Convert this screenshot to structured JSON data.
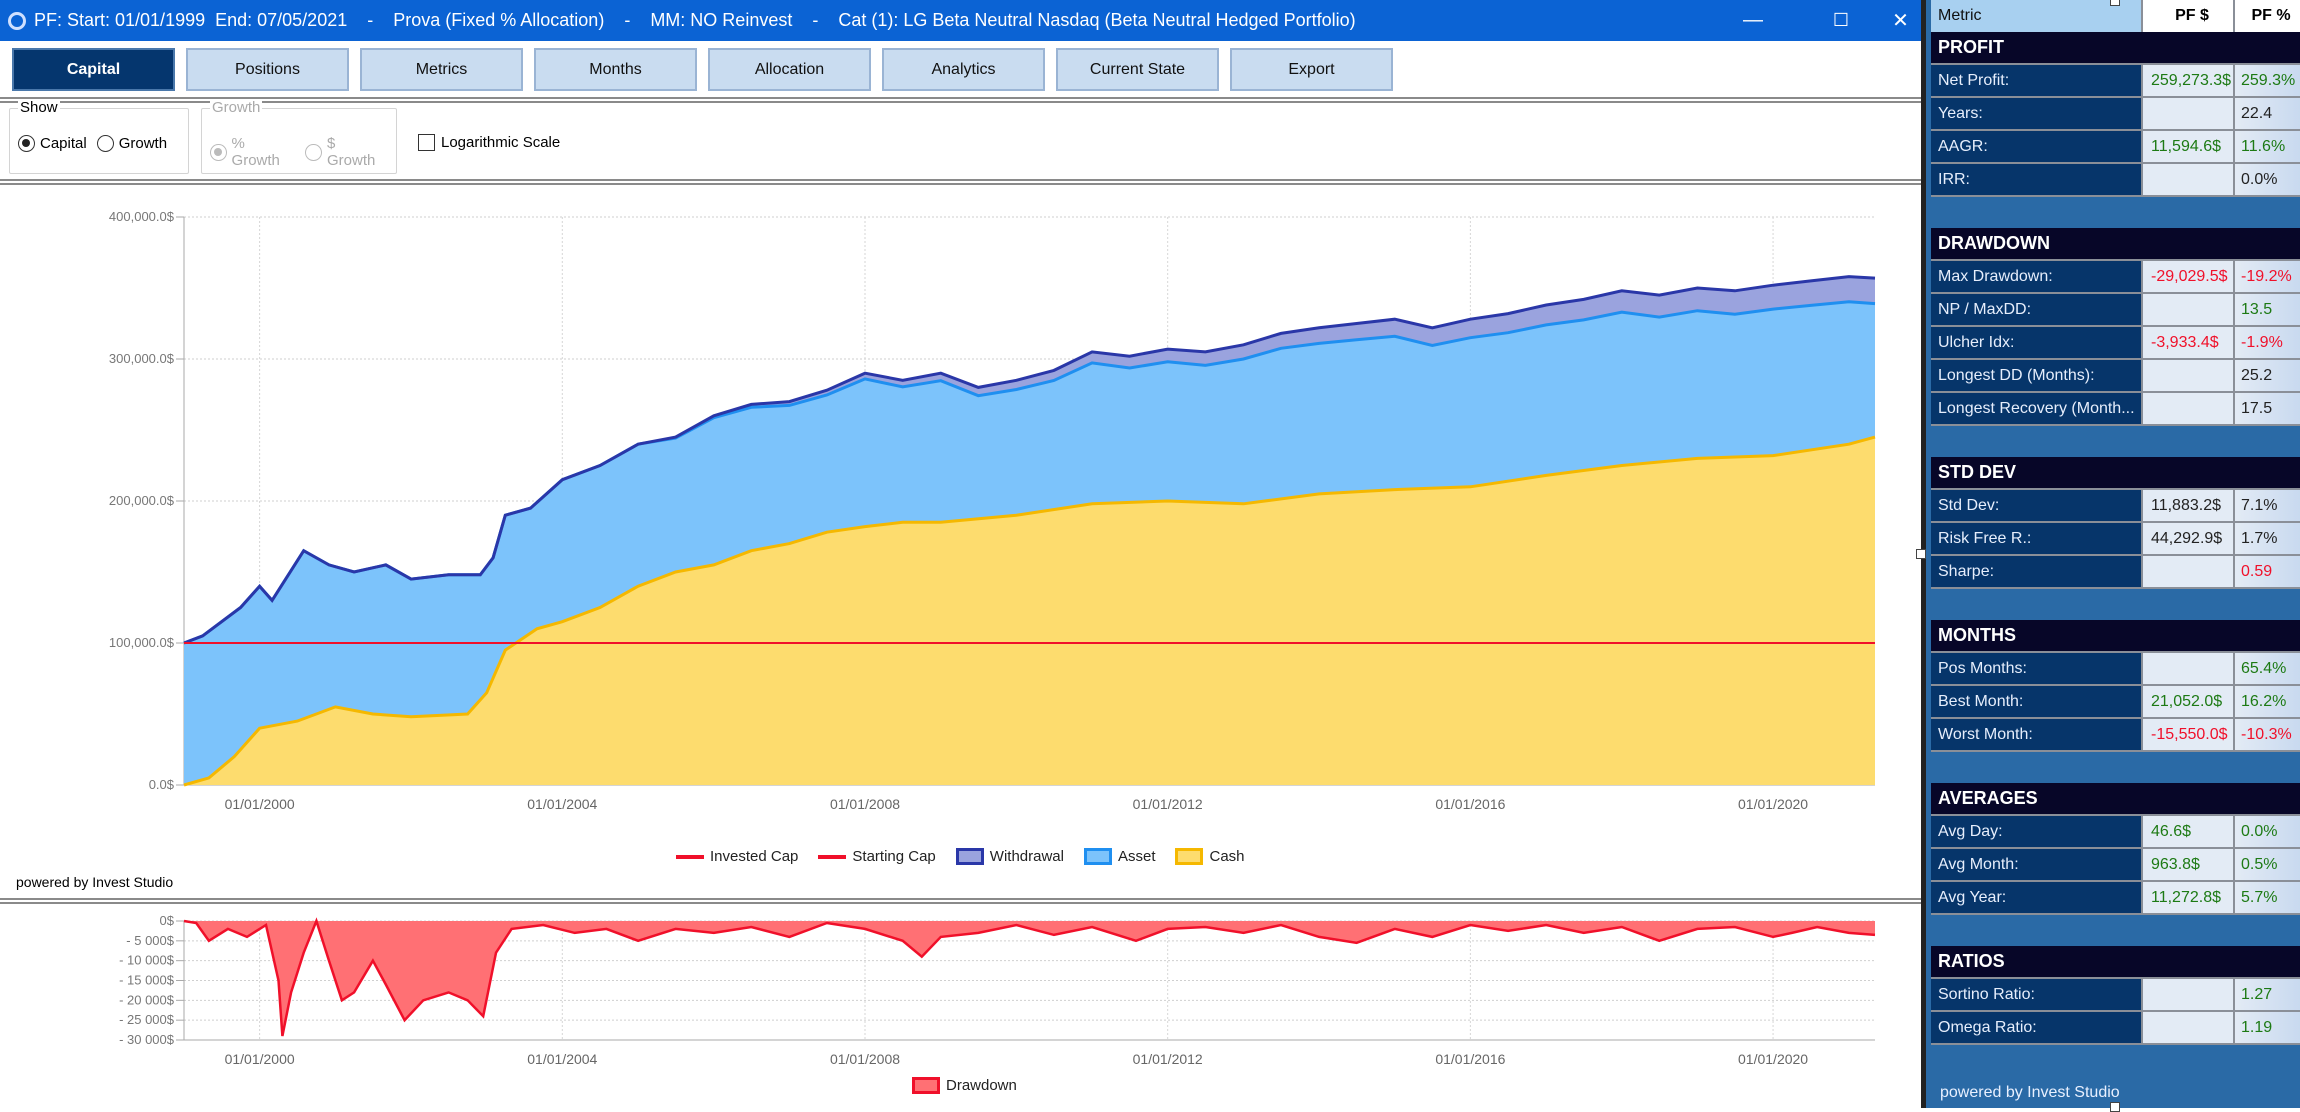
{
  "window": {
    "title": "PF: Start: 01/01/1999  End: 07/05/2021    -    Prova (Fixed % Allocation)    -    MM: NO Reinvest    -    Cat (1): LG Beta Neutral Nasdaq (Beta Neutral Hedged Portfolio)",
    "minimize": "—",
    "maximize": "☐",
    "close": "✕"
  },
  "tabs": [
    {
      "label": "Capital",
      "active": true
    },
    {
      "label": "Positions"
    },
    {
      "label": "Metrics"
    },
    {
      "label": "Months"
    },
    {
      "label": "Allocation"
    },
    {
      "label": "Analytics"
    },
    {
      "label": "Current State"
    },
    {
      "label": "Export"
    }
  ],
  "options": {
    "show_label": "Show",
    "capital": "Capital",
    "growth": "Growth",
    "growth_label": "Growth",
    "pct_growth": "% Growth",
    "usd_growth": "$ Growth",
    "log_scale": "Logarithmic Scale",
    "selected_show": "Capital",
    "selected_growth": "% Growth",
    "log_checked": false
  },
  "powered_by": "powered by Invest Studio",
  "chart_data": [
    {
      "type": "area",
      "title": "",
      "xlabel": "",
      "ylabel": "",
      "xlim": [
        "1999-01-01",
        "2021-05-07"
      ],
      "ylim": [
        0,
        400000
      ],
      "grid": true,
      "legend_placement": "bottom",
      "yticks": [
        {
          "v": 0,
          "label": "0.0$"
        },
        {
          "v": 100000,
          "label": "100,000.0$"
        },
        {
          "v": 200000,
          "label": "200,000.0$"
        },
        {
          "v": 300000,
          "label": "300,000.0$"
        },
        {
          "v": 400000,
          "label": "400,000.0$"
        }
      ],
      "xticks": [
        {
          "d": "2000-01-01",
          "label": "01/01/2000"
        },
        {
          "d": "2004-01-01",
          "label": "01/01/2004"
        },
        {
          "d": "2008-01-01",
          "label": "01/01/2008"
        },
        {
          "d": "2012-01-01",
          "label": "01/01/2012"
        },
        {
          "d": "2016-01-01",
          "label": "01/01/2016"
        },
        {
          "d": "2020-01-01",
          "label": "01/01/2020"
        }
      ],
      "colors": {
        "invested": "#f0102a",
        "starting": "#f0102a",
        "withdrawal_fill": "#9aa3de",
        "withdrawal_line": "#2a37a8",
        "asset_fill": "#7cc3fb",
        "asset_line": "#1f8ff0",
        "cash_fill": "#fddc6e",
        "cash_line": "#f5b800"
      },
      "legend": [
        "Invested Cap",
        "Starting Cap",
        "Withdrawal",
        "Asset",
        "Cash"
      ],
      "series": {
        "total": [
          [
            "1999-01-01",
            100000
          ],
          [
            "1999-04-01",
            105000
          ],
          [
            "1999-10-01",
            125000
          ],
          [
            "2000-01-01",
            140000
          ],
          [
            "2000-03-01",
            130000
          ],
          [
            "2000-08-01",
            165000
          ],
          [
            "2000-12-01",
            155000
          ],
          [
            "2001-04-01",
            150000
          ],
          [
            "2001-09-01",
            155000
          ],
          [
            "2002-01-01",
            145000
          ],
          [
            "2002-07-01",
            148000
          ],
          [
            "2002-12-01",
            148000
          ],
          [
            "2003-02-01",
            160000
          ],
          [
            "2003-04-01",
            190000
          ],
          [
            "2003-08-01",
            195000
          ],
          [
            "2004-01-01",
            215000
          ],
          [
            "2004-07-01",
            225000
          ],
          [
            "2005-01-01",
            240000
          ],
          [
            "2005-07-01",
            245000
          ],
          [
            "2006-01-01",
            260000
          ],
          [
            "2006-07-01",
            268000
          ],
          [
            "2007-01-01",
            270000
          ],
          [
            "2007-07-01",
            278000
          ],
          [
            "2008-01-01",
            290000
          ],
          [
            "2008-07-01",
            285000
          ],
          [
            "2009-01-01",
            290000
          ],
          [
            "2009-07-01",
            280000
          ],
          [
            "2010-01-01",
            285000
          ],
          [
            "2010-07-01",
            292000
          ],
          [
            "2011-01-01",
            305000
          ],
          [
            "2011-07-01",
            302000
          ],
          [
            "2012-01-01",
            307000
          ],
          [
            "2012-07-01",
            305000
          ],
          [
            "2013-01-01",
            310000
          ],
          [
            "2013-07-01",
            318000
          ],
          [
            "2014-01-01",
            322000
          ],
          [
            "2014-07-01",
            325000
          ],
          [
            "2015-01-01",
            328000
          ],
          [
            "2015-07-01",
            322000
          ],
          [
            "2016-01-01",
            328000
          ],
          [
            "2016-07-01",
            332000
          ],
          [
            "2017-01-01",
            338000
          ],
          [
            "2017-07-01",
            342000
          ],
          [
            "2018-01-01",
            348000
          ],
          [
            "2018-07-01",
            345000
          ],
          [
            "2019-01-01",
            350000
          ],
          [
            "2019-07-01",
            348000
          ],
          [
            "2020-01-01",
            352000
          ],
          [
            "2020-07-01",
            355000
          ],
          [
            "2021-01-01",
            358000
          ],
          [
            "2021-05-07",
            357000
          ]
        ],
        "withdrawal": [
          [
            "1999-01-01",
            0
          ],
          [
            "2005-01-01",
            0
          ],
          [
            "2008-01-01",
            4000
          ],
          [
            "2012-01-01",
            9000
          ],
          [
            "2016-01-01",
            13000
          ],
          [
            "2019-01-01",
            16000
          ],
          [
            "2021-05-07",
            18000
          ]
        ],
        "cash": [
          [
            "1999-01-01",
            0
          ],
          [
            "1999-05-01",
            5000
          ],
          [
            "1999-09-01",
            20000
          ],
          [
            "2000-01-01",
            40000
          ],
          [
            "2000-07-01",
            45000
          ],
          [
            "2001-01-01",
            55000
          ],
          [
            "2001-07-01",
            50000
          ],
          [
            "2002-01-01",
            48000
          ],
          [
            "2002-10-01",
            50000
          ],
          [
            "2003-01-01",
            65000
          ],
          [
            "2003-04-01",
            95000
          ],
          [
            "2003-09-01",
            110000
          ],
          [
            "2004-01-01",
            115000
          ],
          [
            "2004-07-01",
            125000
          ],
          [
            "2005-01-01",
            140000
          ],
          [
            "2005-07-01",
            150000
          ],
          [
            "2006-01-01",
            155000
          ],
          [
            "2006-07-01",
            165000
          ],
          [
            "2007-01-01",
            170000
          ],
          [
            "2007-07-01",
            178000
          ],
          [
            "2008-01-01",
            182000
          ],
          [
            "2008-07-01",
            185000
          ],
          [
            "2009-01-01",
            185000
          ],
          [
            "2010-01-01",
            190000
          ],
          [
            "2011-01-01",
            198000
          ],
          [
            "2012-01-01",
            200000
          ],
          [
            "2013-01-01",
            198000
          ],
          [
            "2014-01-01",
            205000
          ],
          [
            "2015-01-01",
            208000
          ],
          [
            "2016-01-01",
            210000
          ],
          [
            "2017-01-01",
            218000
          ],
          [
            "2018-01-01",
            225000
          ],
          [
            "2019-01-01",
            230000
          ],
          [
            "2020-01-01",
            232000
          ],
          [
            "2021-01-01",
            240000
          ],
          [
            "2021-05-07",
            245000
          ]
        ],
        "invested_cap": 100000,
        "starting_cap": 100000
      }
    },
    {
      "type": "area",
      "title": "",
      "xlabel": "",
      "ylabel": "",
      "xlim": [
        "1999-01-01",
        "2021-05-07"
      ],
      "ylim": [
        -30000,
        0
      ],
      "grid": true,
      "legend_placement": "bottom",
      "yticks": [
        {
          "v": 0,
          "label": "0$"
        },
        {
          "v": -5000,
          "label": "- 5 000$"
        },
        {
          "v": -10000,
          "label": "- 10 000$"
        },
        {
          "v": -15000,
          "label": "- 15 000$"
        },
        {
          "v": -20000,
          "label": "- 20 000$"
        },
        {
          "v": -25000,
          "label": "- 25 000$"
        },
        {
          "v": -30000,
          "label": "- 30 000$"
        }
      ],
      "xticks": [
        {
          "d": "2000-01-01",
          "label": "01/01/2000"
        },
        {
          "d": "2004-01-01",
          "label": "01/01/2004"
        },
        {
          "d": "2008-01-01",
          "label": "01/01/2008"
        },
        {
          "d": "2012-01-01",
          "label": "01/01/2012"
        },
        {
          "d": "2016-01-01",
          "label": "01/01/2016"
        },
        {
          "d": "2020-01-01",
          "label": "01/01/2020"
        }
      ],
      "colors": {
        "fill": "#ff7074",
        "line": "#f0102a"
      },
      "legend": [
        "Drawdown"
      ],
      "series": {
        "drawdown": [
          [
            "1999-01-01",
            0
          ],
          [
            "1999-03-01",
            -500
          ],
          [
            "1999-05-01",
            -5000
          ],
          [
            "1999-08-01",
            -2000
          ],
          [
            "1999-11-01",
            -4000
          ],
          [
            "2000-02-01",
            -1000
          ],
          [
            "2000-04-01",
            -15000
          ],
          [
            "2000-04-20",
            -29000
          ],
          [
            "2000-06-01",
            -18000
          ],
          [
            "2000-08-01",
            -8000
          ],
          [
            "2000-10-01",
            0
          ],
          [
            "2000-12-01",
            -10000
          ],
          [
            "2001-02-01",
            -20000
          ],
          [
            "2001-04-01",
            -18000
          ],
          [
            "2001-07-01",
            -10000
          ],
          [
            "2001-09-01",
            -16000
          ],
          [
            "2001-12-01",
            -25000
          ],
          [
            "2002-03-01",
            -20000
          ],
          [
            "2002-07-01",
            -18000
          ],
          [
            "2002-10-01",
            -20000
          ],
          [
            "2002-12-15",
            -24000
          ],
          [
            "2003-02-15",
            -8000
          ],
          [
            "2003-05-01",
            -2000
          ],
          [
            "2003-10-01",
            -1000
          ],
          [
            "2004-03-01",
            -3000
          ],
          [
            "2004-08-01",
            -2000
          ],
          [
            "2005-01-01",
            -5000
          ],
          [
            "2005-07-01",
            -2000
          ],
          [
            "2006-01-01",
            -3000
          ],
          [
            "2006-07-01",
            -1500
          ],
          [
            "2007-01-01",
            -4000
          ],
          [
            "2007-07-01",
            -500
          ],
          [
            "2008-01-01",
            -2000
          ],
          [
            "2008-07-01",
            -5000
          ],
          [
            "2008-10-01",
            -9000
          ],
          [
            "2009-01-01",
            -4000
          ],
          [
            "2009-07-01",
            -3000
          ],
          [
            "2010-01-01",
            -1000
          ],
          [
            "2010-07-01",
            -3500
          ],
          [
            "2011-01-01",
            -1500
          ],
          [
            "2011-08-01",
            -5000
          ],
          [
            "2012-01-01",
            -2000
          ],
          [
            "2012-07-01",
            -1500
          ],
          [
            "2013-01-01",
            -3000
          ],
          [
            "2013-07-01",
            -1000
          ],
          [
            "2014-01-01",
            -4000
          ],
          [
            "2014-07-01",
            -5500
          ],
          [
            "2015-01-01",
            -2000
          ],
          [
            "2015-07-01",
            -4000
          ],
          [
            "2016-01-01",
            -1000
          ],
          [
            "2016-07-01",
            -2500
          ],
          [
            "2017-01-01",
            -1000
          ],
          [
            "2017-07-01",
            -3000
          ],
          [
            "2018-01-01",
            -1500
          ],
          [
            "2018-07-01",
            -5000
          ],
          [
            "2019-01-01",
            -2000
          ],
          [
            "2019-07-01",
            -1500
          ],
          [
            "2020-01-01",
            -4000
          ],
          [
            "2020-04-01",
            -3000
          ],
          [
            "2020-08-01",
            -1500
          ],
          [
            "2021-01-01",
            -3000
          ],
          [
            "2021-05-07",
            -3500
          ]
        ]
      }
    }
  ],
  "metrics": {
    "headers": [
      "Metric",
      "PF $",
      "PF %"
    ],
    "sections": [
      {
        "title": "PROFIT",
        "rows": [
          {
            "m": "Net Profit:",
            "v1": "259,273.3$",
            "v2": "259.3%",
            "c1": "pos",
            "c2": "pos"
          },
          {
            "m": "Years:",
            "v1": "",
            "v2": "22.4",
            "c1": "neu",
            "c2": "neu"
          },
          {
            "m": "AAGR:",
            "v1": "11,594.6$",
            "v2": "11.6%",
            "c1": "pos",
            "c2": "pos"
          },
          {
            "m": "IRR:",
            "v1": "",
            "v2": "0.0%",
            "c1": "neu",
            "c2": "neu"
          }
        ]
      },
      {
        "title": "DRAWDOWN",
        "rows": [
          {
            "m": "Max Drawdown:",
            "v1": "-29,029.5$",
            "v2": "-19.2%",
            "c1": "neg",
            "c2": "neg"
          },
          {
            "m": "NP / MaxDD:",
            "v1": "",
            "v2": "13.5",
            "c1": "neu",
            "c2": "pos"
          },
          {
            "m": "Ulcher Idx:",
            "v1": "-3,933.4$",
            "v2": "-1.9%",
            "c1": "neg",
            "c2": "neg"
          },
          {
            "m": "Longest DD (Months):",
            "v1": "",
            "v2": "25.2",
            "c1": "neu",
            "c2": "neu"
          },
          {
            "m": "Longest Recovery (Month...",
            "v1": "",
            "v2": "17.5",
            "c1": "neu",
            "c2": "neu"
          }
        ]
      },
      {
        "title": "STD DEV",
        "rows": [
          {
            "m": "Std Dev:",
            "v1": "11,883.2$",
            "v2": "7.1%",
            "c1": "neu",
            "c2": "neu"
          },
          {
            "m": "Risk Free R.:",
            "v1": "44,292.9$",
            "v2": "1.7%",
            "c1": "neu",
            "c2": "neu"
          },
          {
            "m": "Sharpe:",
            "v1": "",
            "v2": "0.59",
            "c1": "neu",
            "c2": "neg"
          }
        ]
      },
      {
        "title": "MONTHS",
        "rows": [
          {
            "m": "Pos Months:",
            "v1": "",
            "v2": "65.4%",
            "c1": "neu",
            "c2": "pos"
          },
          {
            "m": "Best Month:",
            "v1": "21,052.0$",
            "v2": "16.2%",
            "c1": "pos",
            "c2": "pos"
          },
          {
            "m": "Worst Month:",
            "v1": "-15,550.0$",
            "v2": "-10.3%",
            "c1": "neg",
            "c2": "neg"
          }
        ]
      },
      {
        "title": "AVERAGES",
        "rows": [
          {
            "m": "Avg Day:",
            "v1": "46.6$",
            "v2": "0.0%",
            "c1": "pos",
            "c2": "pos"
          },
          {
            "m": "Avg Month:",
            "v1": "963.8$",
            "v2": "0.5%",
            "c1": "pos",
            "c2": "pos"
          },
          {
            "m": "Avg Year:",
            "v1": "11,272.8$",
            "v2": "5.7%",
            "c1": "pos",
            "c2": "pos"
          }
        ]
      },
      {
        "title": "RATIOS",
        "rows": [
          {
            "m": "Sortino Ratio:",
            "v1": "",
            "v2": "1.27",
            "c1": "neu",
            "c2": "pos"
          },
          {
            "m": "Omega Ratio:",
            "v1": "",
            "v2": "1.19",
            "c1": "neu",
            "c2": "pos"
          }
        ]
      }
    ],
    "powered_by": "powered by Invest Studio"
  }
}
